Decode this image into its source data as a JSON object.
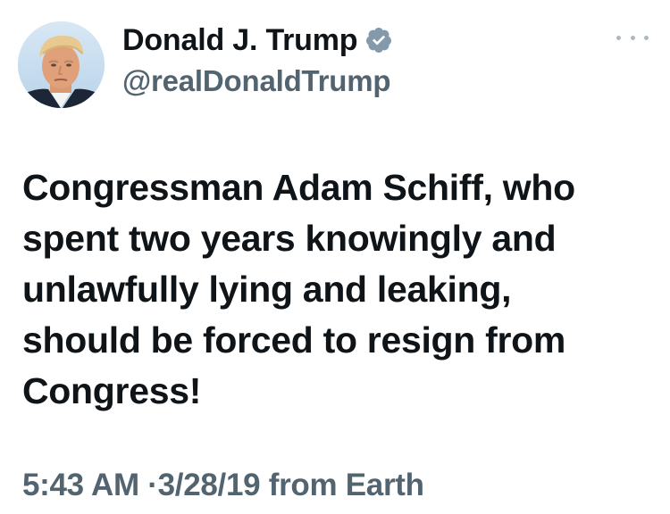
{
  "author": {
    "display_name": "Donald J. Trump",
    "handle": "@realDonaldTrump",
    "verified": true,
    "avatar_icon": "profile-photo"
  },
  "tweet": {
    "text": "Congressman Adam Schiff, who\nspent two years knowingly and\nunlawfully lying and leaking,\nshould be forced to resign from\nCongress!",
    "time": "5:43 AM",
    "separator": "·",
    "date": "3/28/19",
    "source": "from Earth"
  },
  "icons": {
    "verified": "verified-badge-icon",
    "more": "more-options-icon"
  },
  "colors": {
    "text_primary": "#0f1419",
    "text_secondary": "#536471",
    "verified_badge": "#829aab",
    "more_dots": "#aab8c2"
  }
}
